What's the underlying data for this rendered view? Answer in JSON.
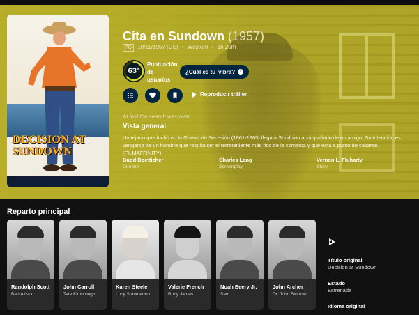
{
  "movie": {
    "title": "Cita en Sundown",
    "year": "(1957)",
    "certification": "PG",
    "release": "10/11/1957 (US)",
    "genre": "Western",
    "runtime": "1h 20m",
    "poster_title_line1": "DECISION AT",
    "poster_title_line2": "SUNDOWN"
  },
  "score": {
    "value": 63,
    "display": "63",
    "unit": "%",
    "label_line1": "Puntuación",
    "label_line2": "de",
    "label_line3": "usuarios",
    "ring_color": "#d2d531"
  },
  "vibe": {
    "prefix": "¿Cuál es tu",
    "link": "vibra",
    "suffix": "?",
    "info_icon": "i"
  },
  "actions": {
    "list_icon": "list-icon",
    "favorite_icon": "heart-icon",
    "watchlist_icon": "bookmark-icon",
    "play_label": "Reproducir tráiler"
  },
  "tagline": "At last the search was over...",
  "overview": {
    "heading": "Vista general",
    "text": "Un tejano que luchó en la Guerra de Secesión (1861-1865) llega a Sundown acompañado de un amigo. Su intención es vengarse de un hombre que resulta ser el terrateniente más rico de la comarca y que está a punto de casarse. (FILMAFFINITY)"
  },
  "crew": [
    {
      "name": "Budd Boetticher",
      "role": "Director"
    },
    {
      "name": "Charles Lang",
      "role": "Screenplay"
    },
    {
      "name": "Vernon L. Fluharty",
      "role": "Story"
    }
  ],
  "cast": {
    "heading": "Reparto principal",
    "members": [
      {
        "name": "Randolph Scott",
        "character": "Bart Allison"
      },
      {
        "name": "John Carroll",
        "character": "Tate Kimbrough"
      },
      {
        "name": "Karen Steele",
        "character": "Lucy Summerton"
      },
      {
        "name": "Valerie French",
        "character": "Ruby James"
      },
      {
        "name": "Noah Beery Jr.",
        "character": "Sam"
      },
      {
        "name": "John Archer",
        "character": "Dr. John Storrow"
      }
    ]
  },
  "facts": {
    "original_title_label": "Título original",
    "original_title_value": "Decision at Sundown",
    "status_label": "Estado",
    "status_value": "Estrenada",
    "language_label": "Idioma original"
  },
  "colors": {
    "hero_tint": "#b8ad2a",
    "button_bg": "#032541",
    "page_bg": "#111111"
  }
}
